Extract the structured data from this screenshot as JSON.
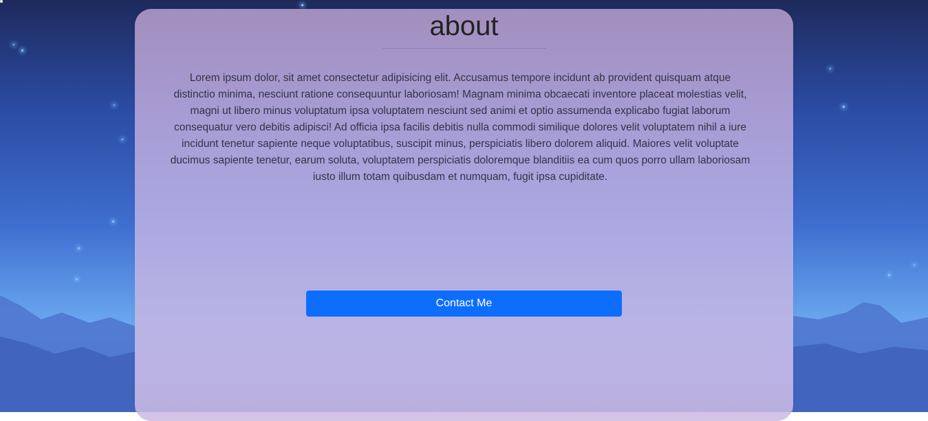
{
  "about": {
    "title": "about",
    "paragraph": "Lorem ipsum dolor, sit amet consectetur adipisicing elit. Accusamus tempore incidunt ab provident quisquam atque distinctio minima, nesciunt ratione consequuntur laboriosam! Magnam minima obcaecati inventore placeat molestias velit, magni ut libero minus voluptatum ipsa voluptatem nesciunt sed animi et optio assumenda explicabo fugiat laborum consequatur vero debitis adipisci! Ad officia ipsa facilis debitis nulla commodi similique dolores velit voluptatem nihil a iure incidunt tenetur sapiente neque voluptatibus, suscipit minus, perspiciatis libero dolorem aliquid. Maiores velit voluptate ducimus sapiente tenetur, earum soluta, voluptatem perspiciatis doloremque blanditiis ea cum quos porro ullam laboriosam iusto illum totam quibusdam et numquam, fugit ipsa cupiditate.",
    "button_label": "Contact Me"
  },
  "colors": {
    "button": "#0d6efd",
    "title": "#222222",
    "text": "#333344"
  }
}
